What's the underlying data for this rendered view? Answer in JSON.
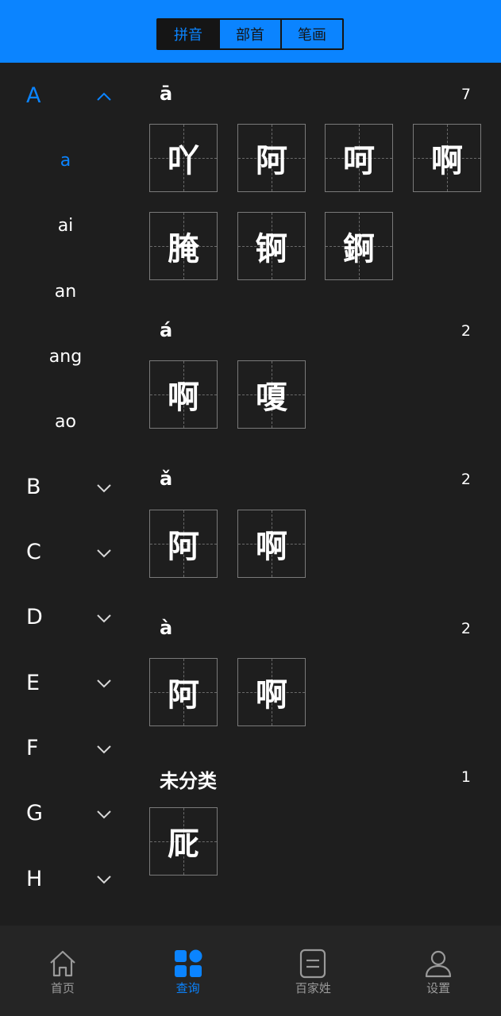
{
  "header": {
    "tabs": [
      {
        "label": "拼音",
        "active": true
      },
      {
        "label": "部首",
        "active": false
      },
      {
        "label": "笔画",
        "active": false
      }
    ]
  },
  "sidebar": {
    "letters": [
      "A",
      "B",
      "C",
      "D",
      "E",
      "F",
      "G",
      "H"
    ],
    "active_letter": "A",
    "sub_items": [
      "a",
      "ai",
      "an",
      "ang",
      "ao"
    ],
    "active_sub": "a"
  },
  "sections": [
    {
      "title": "ā",
      "count": "7",
      "chars": [
        "吖",
        "阿",
        "呵",
        "啊",
        "腌",
        "锕",
        "錒"
      ]
    },
    {
      "title": "á",
      "count": "2",
      "chars": [
        "啊",
        "嗄"
      ]
    },
    {
      "title": "ǎ",
      "count": "2",
      "chars": [
        "阿",
        "啊"
      ]
    },
    {
      "title": "à",
      "count": "2",
      "chars": [
        "阿",
        "啊"
      ]
    },
    {
      "title": "未分类",
      "count": "1",
      "chars": [
        "厑"
      ]
    }
  ],
  "bottom_nav": [
    {
      "label": "首页",
      "icon": "home-icon",
      "active": false
    },
    {
      "label": "查询",
      "icon": "grid-icon",
      "active": true
    },
    {
      "label": "百家姓",
      "icon": "book-icon",
      "active": false
    },
    {
      "label": "设置",
      "icon": "user-icon",
      "active": false
    }
  ],
  "colors": {
    "accent": "#0b84ff",
    "background": "#1e1e1e",
    "nav_bg": "#252525"
  }
}
